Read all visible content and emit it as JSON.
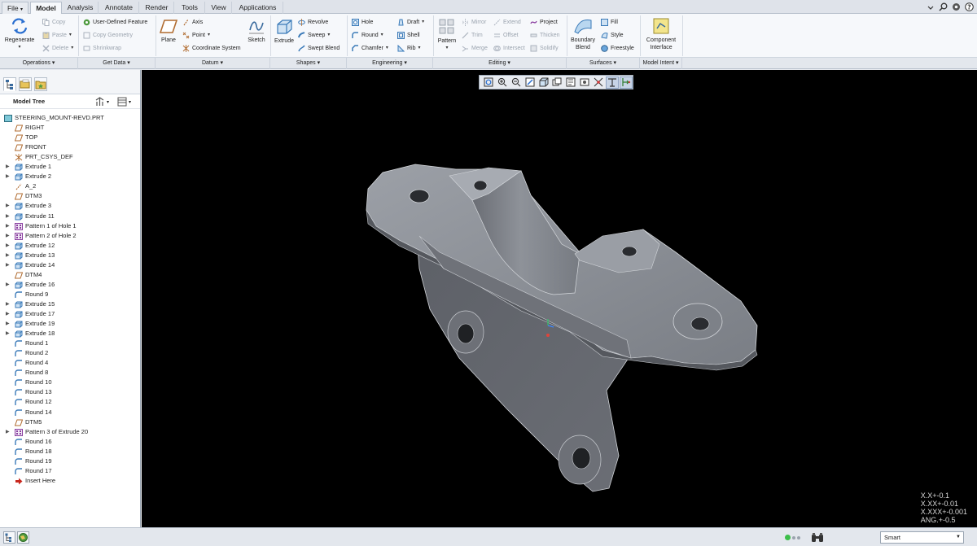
{
  "tabs": [
    {
      "label": "File",
      "dropdown": "▾"
    },
    {
      "label": "Model"
    },
    {
      "label": "Analysis"
    },
    {
      "label": "Annotate"
    },
    {
      "label": "Render"
    },
    {
      "label": "Tools"
    },
    {
      "label": "View"
    },
    {
      "label": "Applications"
    }
  ],
  "operations": {
    "regenerate": "Regenerate",
    "copy": "Copy",
    "paste": "Paste",
    "delete": "Delete"
  },
  "get_data": {
    "user_defined_feature": "User-Defined Feature",
    "copy_geometry": "Copy Geometry",
    "shrinkwrap": "Shrinkwrap"
  },
  "datum": {
    "plane": "Plane",
    "axis": "Axis",
    "point": "Point",
    "coordinate_system": "Coordinate System",
    "sketch": "Sketch"
  },
  "shapes": {
    "extrude": "Extrude",
    "revolve": "Revolve",
    "sweep": "Sweep",
    "swept_blend": "Swept Blend"
  },
  "engineering": {
    "hole": "Hole",
    "round": "Round",
    "chamfer": "Chamfer",
    "draft": "Draft",
    "shell": "Shell",
    "rib": "Rib"
  },
  "editing": {
    "pattern": "Pattern",
    "mirror": "Mirror",
    "trim": "Trim",
    "merge": "Merge",
    "extend": "Extend",
    "offset": "Offset",
    "intersect": "Intersect",
    "project": "Project",
    "thicken": "Thicken",
    "solidify": "Solidify"
  },
  "surfaces": {
    "boundary_blend": "Boundary Blend",
    "fill": "Fill",
    "style": "Style",
    "freestyle": "Freestyle"
  },
  "model_intent": {
    "component_interface": "Component Interface"
  },
  "groups": [
    {
      "label": "Operations ▾"
    },
    {
      "label": "Get Data ▾"
    },
    {
      "label": "Datum ▾"
    },
    {
      "label": "Shapes ▾"
    },
    {
      "label": "Engineering ▾"
    },
    {
      "label": "Editing ▾"
    },
    {
      "label": "Surfaces ▾"
    },
    {
      "label": "Model Intent ▾"
    }
  ],
  "model_tree": {
    "title": "Model Tree",
    "items": [
      {
        "label": "STEERING_MOUNT-REVD.PRT",
        "icon": "part-icon",
        "expand": false,
        "root": true
      },
      {
        "label": "RIGHT",
        "icon": "datum-plane-icon",
        "expand": false
      },
      {
        "label": "TOP",
        "icon": "datum-plane-icon",
        "expand": false
      },
      {
        "label": "FRONT",
        "icon": "datum-plane-icon",
        "expand": false
      },
      {
        "label": "PRT_CSYS_DEF",
        "icon": "csys-icon",
        "expand": false
      },
      {
        "label": "Extrude 1",
        "icon": "extrude-icon",
        "expand": true
      },
      {
        "label": "Extrude 2",
        "icon": "extrude-icon",
        "expand": true
      },
      {
        "label": "A_2",
        "icon": "axis-icon",
        "expand": false
      },
      {
        "label": "DTM3",
        "icon": "datum-plane-icon",
        "expand": false
      },
      {
        "label": "Extrude 3",
        "icon": "extrude-icon",
        "expand": true
      },
      {
        "label": "Extrude 11",
        "icon": "extrude-icon",
        "expand": true
      },
      {
        "label": "Pattern 1 of Hole 1",
        "icon": "pattern-icon",
        "expand": true
      },
      {
        "label": "Pattern 2 of Hole 2",
        "icon": "pattern-icon",
        "expand": true
      },
      {
        "label": "Extrude 12",
        "icon": "extrude-icon",
        "expand": true
      },
      {
        "label": "Extrude 13",
        "icon": "extrude-icon",
        "expand": true
      },
      {
        "label": "Extrude 14",
        "icon": "extrude-icon",
        "expand": true
      },
      {
        "label": "DTM4",
        "icon": "datum-plane-icon",
        "expand": false
      },
      {
        "label": "Extrude 16",
        "icon": "extrude-icon",
        "expand": true
      },
      {
        "label": "Round 9",
        "icon": "round-icon",
        "expand": false
      },
      {
        "label": "Extrude 15",
        "icon": "extrude-icon",
        "expand": true
      },
      {
        "label": "Extrude 17",
        "icon": "extrude-icon",
        "expand": true
      },
      {
        "label": "Extrude 19",
        "icon": "extrude-icon",
        "expand": true
      },
      {
        "label": "Extrude 18",
        "icon": "extrude-icon",
        "expand": true
      },
      {
        "label": "Round 1",
        "icon": "round-icon",
        "expand": false
      },
      {
        "label": "Round 2",
        "icon": "round-icon",
        "expand": false
      },
      {
        "label": "Round 4",
        "icon": "round-icon",
        "expand": false
      },
      {
        "label": "Round 8",
        "icon": "round-icon",
        "expand": false
      },
      {
        "label": "Round 10",
        "icon": "round-icon",
        "expand": false
      },
      {
        "label": "Round 13",
        "icon": "round-icon",
        "expand": false
      },
      {
        "label": "Round 12",
        "icon": "round-icon",
        "expand": false
      },
      {
        "label": "Round 14",
        "icon": "round-icon",
        "expand": false
      },
      {
        "label": "DTM5",
        "icon": "datum-plane-icon",
        "expand": false
      },
      {
        "label": "Pattern 3 of Extrude 20",
        "icon": "pattern-icon",
        "expand": true
      },
      {
        "label": "Round 16",
        "icon": "round-icon",
        "expand": false
      },
      {
        "label": "Round 18",
        "icon": "round-icon",
        "expand": false
      },
      {
        "label": "Round 19",
        "icon": "round-icon",
        "expand": false
      },
      {
        "label": "Round 17",
        "icon": "round-icon",
        "expand": false
      },
      {
        "label": "Insert Here",
        "icon": "insert-arrow-icon",
        "expand": false
      }
    ]
  },
  "viewport": {
    "accuracy": [
      "X.X+-0.1",
      "X.XX+-0.01",
      "X.XXX+-0.001",
      "ANG.+-0.5"
    ]
  },
  "status": {
    "filter_value": "Smart"
  },
  "colors": {
    "accent": "#2a6fd0",
    "part_gray": "#6e7178",
    "viewport_bg": "#000000",
    "ribbon_bg": "#f6f8fb"
  }
}
